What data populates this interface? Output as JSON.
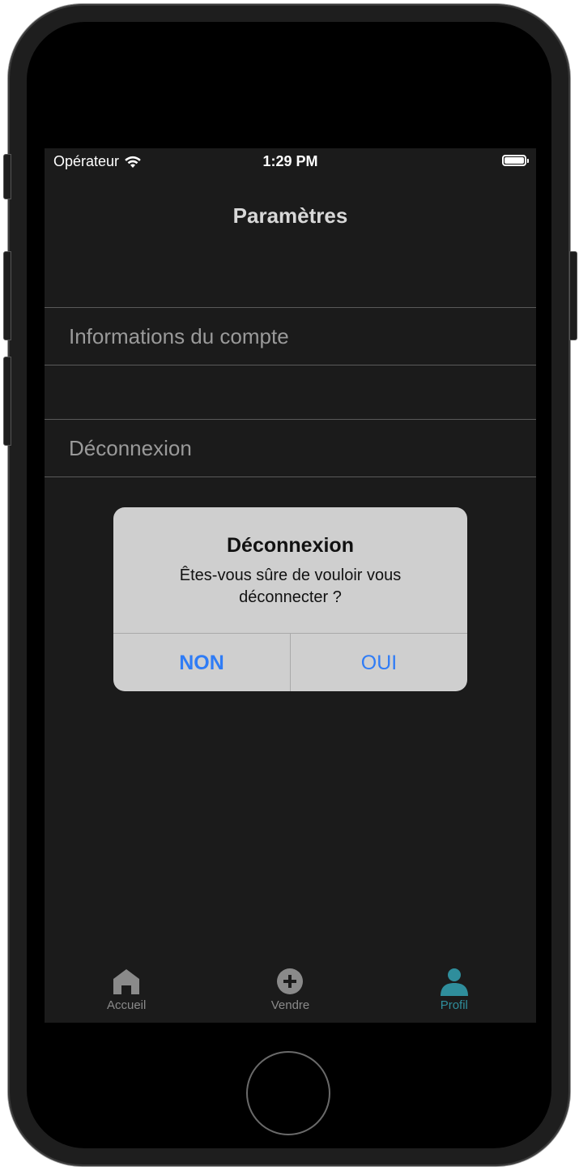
{
  "status_bar": {
    "carrier": "Opérateur",
    "time": "1:29 PM"
  },
  "nav": {
    "title": "Paramètres"
  },
  "settings": {
    "items": [
      {
        "label": "Informations du compte"
      },
      {
        "label": "Déconnexion"
      }
    ]
  },
  "alert": {
    "title": "Déconnexion",
    "message": "Êtes-vous sûre de vouloir vous déconnecter ?",
    "buttons": {
      "no": "NON",
      "yes": "OUI"
    }
  },
  "tab_bar": {
    "tabs": [
      {
        "label": "Accueil",
        "icon": "home-icon",
        "active": false
      },
      {
        "label": "Vendre",
        "icon": "plus-circle-icon",
        "active": false
      },
      {
        "label": "Profil",
        "icon": "person-icon",
        "active": true
      }
    ]
  },
  "colors": {
    "accent_blue": "#2f7cf6",
    "active_tab": "#2f8e9c",
    "background": "#1b1b1b"
  }
}
